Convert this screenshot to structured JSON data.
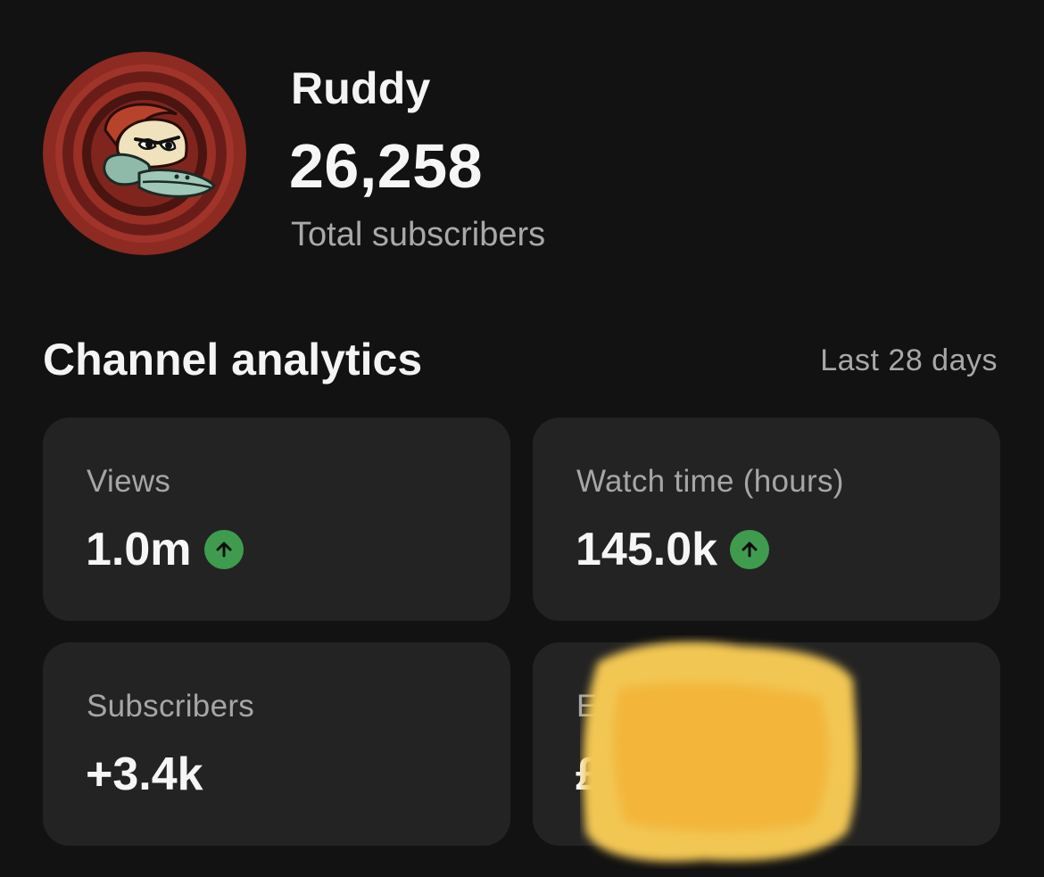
{
  "channel": {
    "name": "Ruddy",
    "subscriber_count": "26,258",
    "subscriber_caption": "Total subscribers"
  },
  "analytics": {
    "title": "Channel analytics",
    "date_range": "Last 28 days",
    "cards": [
      {
        "label": "Views",
        "value": "1.0m",
        "trend": "up"
      },
      {
        "label": "Watch time (hours)",
        "value": "145.0k",
        "trend": "up"
      },
      {
        "label": "Subscribers",
        "value": "+3.4k",
        "trend": "none"
      },
      {
        "label": "E",
        "value": "£",
        "redacted": true,
        "redaction_color": "#f3b63b"
      }
    ]
  },
  "colors": {
    "background": "#121212",
    "card": "#232323",
    "trend_up": "#3f9c4f",
    "secondary_text": "#a6a6a6"
  },
  "icons": {
    "trend_up": "arrow-up-circle-icon"
  }
}
